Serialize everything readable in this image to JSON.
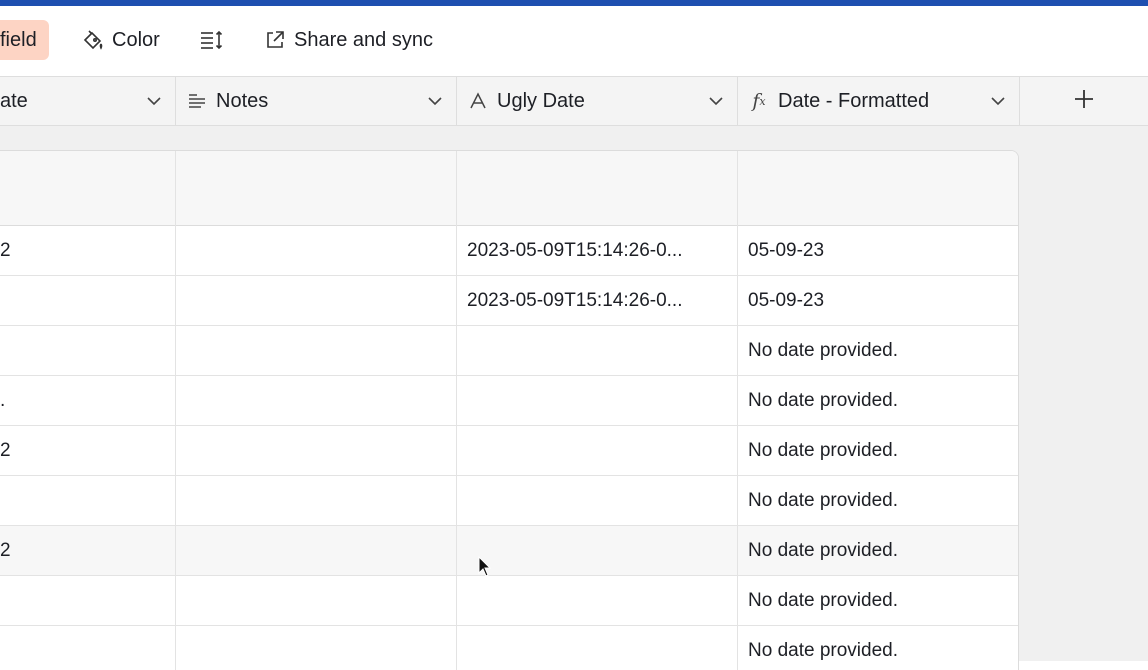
{
  "toolbar": {
    "field_label": "field",
    "color_label": "Color",
    "share_label": "Share and sync"
  },
  "columns": [
    {
      "name": "ate",
      "icon": "calendar-icon"
    },
    {
      "name": "Notes",
      "icon": "long-text-icon"
    },
    {
      "name": "Ugly Date",
      "icon": "text-icon"
    },
    {
      "name": "Date - Formatted",
      "icon": "formula-icon"
    }
  ],
  "add_column_label": "+",
  "rows": [
    {
      "date": "2",
      "notes": "",
      "ugly": "2023-05-09T15:14:26-0...",
      "formatted": "05-09-23"
    },
    {
      "date": "",
      "notes": "",
      "ugly": "2023-05-09T15:14:26-0...",
      "formatted": "05-09-23"
    },
    {
      "date": "",
      "notes": "",
      "ugly": "",
      "formatted": "No date provided."
    },
    {
      "date": ".",
      "notes": "",
      "ugly": "",
      "formatted": "No date provided."
    },
    {
      "date": "2",
      "notes": "",
      "ugly": "",
      "formatted": "No date provided."
    },
    {
      "date": "",
      "notes": "",
      "ugly": "",
      "formatted": "No date provided."
    },
    {
      "date": "2",
      "notes": "",
      "ugly": "",
      "formatted": "No date provided."
    },
    {
      "date": "",
      "notes": "",
      "ugly": "",
      "formatted": "No date provided."
    },
    {
      "date": "",
      "notes": "",
      "ugly": "",
      "formatted": "No date provided."
    }
  ]
}
